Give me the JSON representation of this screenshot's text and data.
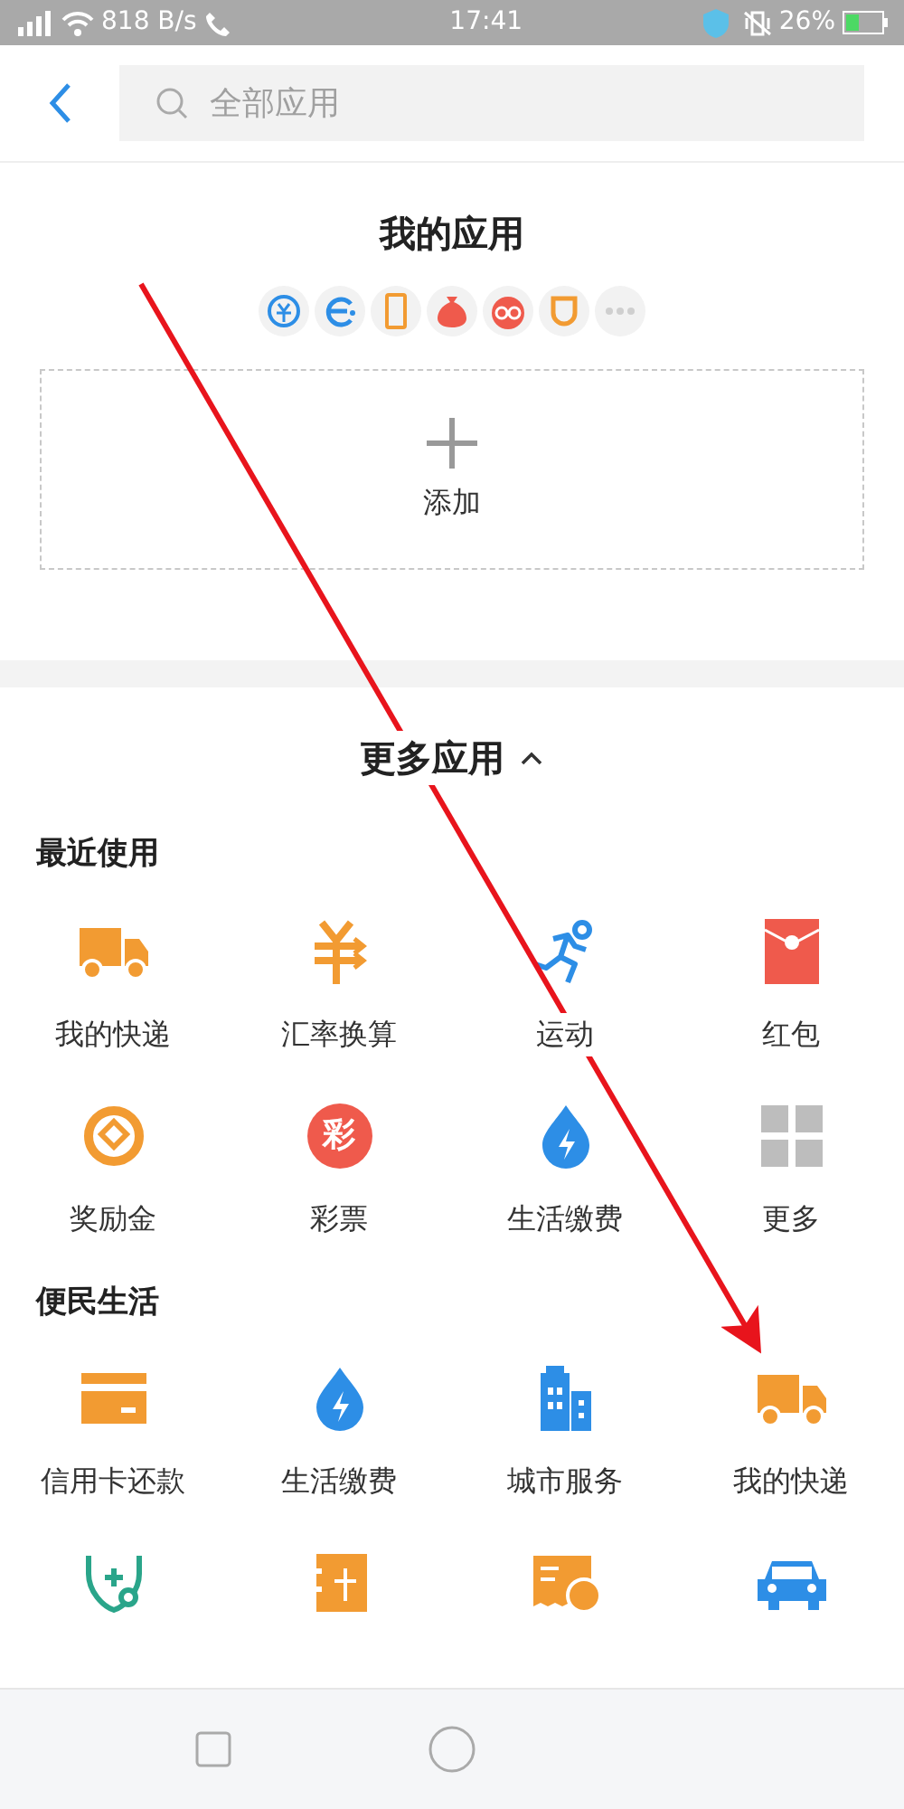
{
  "status_bar": {
    "speed": "818 B/s",
    "time": "17:41",
    "battery": "26%"
  },
  "search": {
    "placeholder": "全部应用"
  },
  "my_apps": {
    "title": "我的应用",
    "add_label": "添加"
  },
  "more_apps": {
    "title": "更多应用",
    "expanded": true
  },
  "sections": [
    {
      "title": "最近使用",
      "apps": [
        {
          "kind": "labeled",
          "label": "我的快递"
        },
        {
          "kind": "labeled",
          "label": "汇率换算"
        },
        {
          "kind": "labeled",
          "label": "运动"
        },
        {
          "kind": "labeled",
          "label": "红包"
        },
        {
          "kind": "labeled",
          "label": "奖励金"
        },
        {
          "kind": "labeled",
          "label": "彩票",
          "glyph": "彩"
        },
        {
          "kind": "labeled",
          "label": "生活缴费"
        },
        {
          "kind": "labeled",
          "label": "更多"
        }
      ]
    },
    {
      "title": "便民生活",
      "apps": [
        {
          "kind": "labeled",
          "label": "信用卡还款"
        },
        {
          "kind": "labeled",
          "label": "生活缴费"
        },
        {
          "kind": "labeled",
          "label": "城市服务"
        },
        {
          "kind": "labeled",
          "label": "我的快递"
        },
        {
          "kind": "icon_only"
        },
        {
          "kind": "icon_only"
        },
        {
          "kind": "icon_only"
        },
        {
          "kind": "icon_only"
        }
      ]
    }
  ]
}
